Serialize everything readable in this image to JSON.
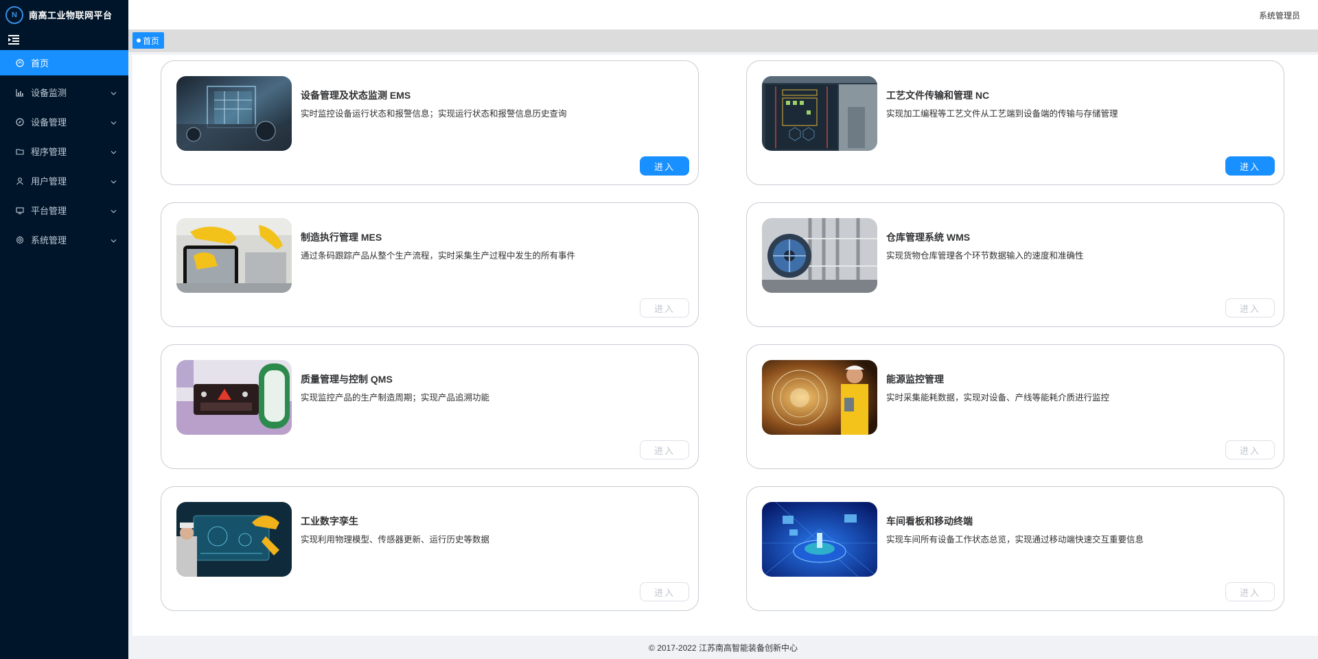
{
  "app": {
    "title": "南高工业物联网平台",
    "logo_mark": "N"
  },
  "header": {
    "user_name": "系统管理员"
  },
  "tags": {
    "home": "首页"
  },
  "sidebar": {
    "items": [
      {
        "label": "首页",
        "icon": "home-icon",
        "active": true,
        "has_children": false
      },
      {
        "label": "设备监测",
        "icon": "chart-icon",
        "active": false,
        "has_children": true
      },
      {
        "label": "设备管理",
        "icon": "compass-icon",
        "active": false,
        "has_children": true
      },
      {
        "label": "程序管理",
        "icon": "folder-icon",
        "active": false,
        "has_children": true
      },
      {
        "label": "用户管理",
        "icon": "user-icon",
        "active": false,
        "has_children": true
      },
      {
        "label": "平台管理",
        "icon": "monitor-icon",
        "active": false,
        "has_children": true
      },
      {
        "label": "系统管理",
        "icon": "gear-icon",
        "active": false,
        "has_children": true
      }
    ]
  },
  "cards": [
    {
      "title": "设备管理及状态监测 EMS",
      "desc": "实时监控设备运行状态和报警信息；实现运行状态和报警信息历史查询",
      "button": "进入",
      "enabled": true,
      "thumb": "ems-thumbnail"
    },
    {
      "title": "工艺文件传输和管理 NC",
      "desc": "实现加工编程等工艺文件从工艺端到设备端的传输与存储管理",
      "button": "进入",
      "enabled": true,
      "thumb": "nc-thumbnail"
    },
    {
      "title": "制造执行管理 MES",
      "desc": "通过条码跟踪产品从整个生产流程，实时采集生产过程中发生的所有事件",
      "button": "进入",
      "enabled": false,
      "thumb": "mes-thumbnail"
    },
    {
      "title": "仓库管理系统 WMS",
      "desc": "实现货物仓库管理各个环节数据输入的速度和准确性",
      "button": "进入",
      "enabled": false,
      "thumb": "wms-thumbnail"
    },
    {
      "title": "质量管理与控制 QMS",
      "desc": "实现监控产品的生产制造周期；实现产品追溯功能",
      "button": "进入",
      "enabled": false,
      "thumb": "qms-thumbnail"
    },
    {
      "title": "能源监控管理",
      "desc": "实时采集能耗数据，实现对设备、产线等能耗介质进行监控",
      "button": "进入",
      "enabled": false,
      "thumb": "energy-thumbnail"
    },
    {
      "title": "工业数字孪生",
      "desc": "实现利用物理模型、传感器更新、运行历史等数据",
      "button": "进入",
      "enabled": false,
      "thumb": "digital-twin-thumbnail"
    },
    {
      "title": "车间看板和移动终端",
      "desc": "实现车间所有设备工作状态总览，实现通过移动端快速交互重要信息",
      "button": "进入",
      "enabled": false,
      "thumb": "dashboard-thumbnail"
    }
  ],
  "footer": {
    "copyright": "© 2017-2022 江苏南高智能装备创新中心"
  }
}
